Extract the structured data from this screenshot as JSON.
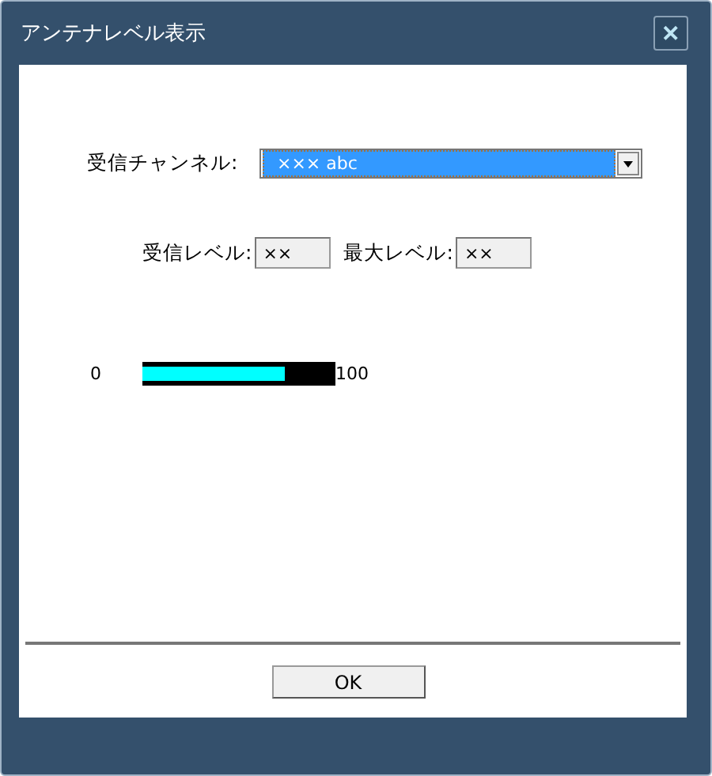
{
  "window": {
    "title": "アンテナレベル表示",
    "close": "✕"
  },
  "channel": {
    "label": "受信チャンネル:",
    "value": "××× abc"
  },
  "levels": [
    {
      "label": "受信レベル:",
      "value": "××"
    },
    {
      "label": "最大レベル:",
      "value": "××"
    }
  ],
  "meter": {
    "min": "0",
    "max": "100",
    "level": 0.74
  },
  "buttons": [
    "OK"
  ]
}
